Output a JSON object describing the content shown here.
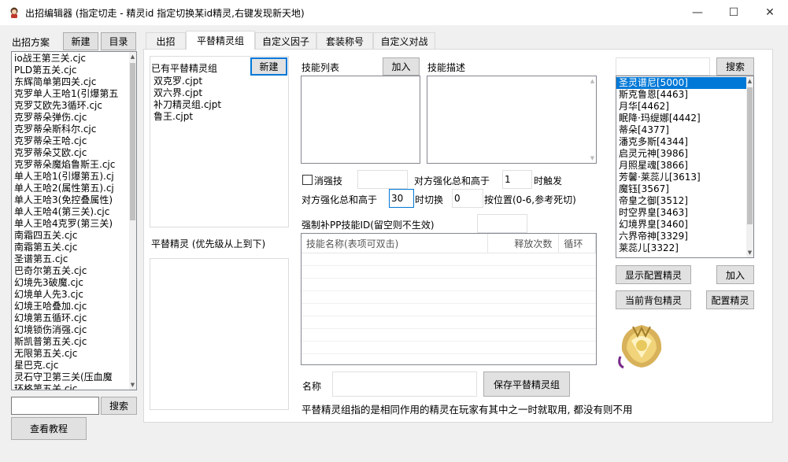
{
  "window": {
    "title": "出招编辑器 (指定切走 - 精灵id 指定切换某id精灵,右键发现新天地)",
    "minimize": "—",
    "maximize": "☐",
    "close": "✕"
  },
  "left": {
    "label": "出招方案",
    "new_label": "新建",
    "dir_label": "目录",
    "plans": [
      "io战王第三关.cjc",
      "PLD第五关.cjc",
      "东辉简单第四关.cjc",
      "克罗单人王哈1(引爆第五",
      "克罗艾欧先3循环.cjc",
      "克罗蒂朵弹伤.cjc",
      "克罗蒂朵斯科尔.cjc",
      "克罗蒂朵王哈.cjc",
      "克罗蒂朵艾欧.cjc",
      "克罗蒂朵魔焰鲁斯王.cjc",
      "单人王哈1(引爆第五).cj",
      "单人王哈2(属性第五).cj",
      "单人王哈3(免控叠属性)",
      "单人王哈4(第三关).cjc",
      "单人王哈4克罗(第三关)",
      "南霜四五关.cjc",
      "南霜第五关.cjc",
      "圣谱第五.cjc",
      "巴奇尔第五关.cjc",
      "幻境先3破魔.cjc",
      "幻境单人先3.cjc",
      "幻境王哈叠加.cjc",
      "幻境第五循环.cjc",
      "幻境锁伤消强.cjc",
      "斯凯普第五关.cjc",
      "无限第五关.cjc",
      "星巴克.cjc",
      "灵石守卫第三关(压血魔",
      "环格第五关.cjc"
    ],
    "search_placeholder": "",
    "search_label": "搜索",
    "tutorial_label": "查看教程"
  },
  "tabs": [
    {
      "label": "出招"
    },
    {
      "label": "平替精灵组"
    },
    {
      "label": "自定义因子"
    },
    {
      "label": "套装称号"
    },
    {
      "label": "自定义对战"
    }
  ],
  "panel": {
    "existing_groups_label": "已有平替精灵组",
    "new_group_label": "新建",
    "groups": [
      "双克罗.cjpt",
      "双六界.cjpt",
      "补刀精灵组.cjpt",
      "鲁王.cjpt"
    ],
    "alt_spirits_label": "平替精灵 (优先级从上到下)",
    "skill_list_label": "技能列表",
    "add_label": "加入",
    "skill_desc_label": "技能描述",
    "cancel_strength_label": "消强技",
    "opp_strength_trigger_label_a": "对方强化总和高于",
    "opp_strength_trigger_value": "1",
    "opp_strength_trigger_label_b": "时触发",
    "switch_label_a": "对方强化总和高于",
    "switch_value": "30",
    "switch_label_b": "时切换",
    "switch_pos_value": "0",
    "switch_pos_label": "按位置(0-6,参考死切)",
    "force_pp_label": "强制补PP技能ID(留空则不生效)",
    "force_pp_value": "",
    "table_headers": [
      "技能名称(表项可双击)",
      "释放次数",
      "循环"
    ],
    "name_label": "名称",
    "name_value": "",
    "save_label": "保存平替精灵组",
    "note": "平替精灵组指的是相同作用的精灵在玩家有其中之一时就取用, 都没有则不用"
  },
  "right": {
    "search_value": "",
    "search_label": "搜索",
    "spirits": [
      "圣灵谱尼[5000]",
      "斯克鲁恩[4463]",
      "月华[4462]",
      "眠降·玛缇娜[4442]",
      "蒂朵[4377]",
      "潘克多斯[4344]",
      "启灵元神[3986]",
      "月照星魂[3866]",
      "芳馨·莱蕊儿[3613]",
      "魔钰[3567]",
      "帝皇之御[3512]",
      "时空界皇[3463]",
      "幻境界皇[3460]",
      "六界帝神[3329]",
      "莱蕊儿[3322]"
    ],
    "show_config_label": "显示配置精灵",
    "add_label": "加入",
    "bag_label": "当前背包精灵",
    "config_label": "配置精灵"
  }
}
